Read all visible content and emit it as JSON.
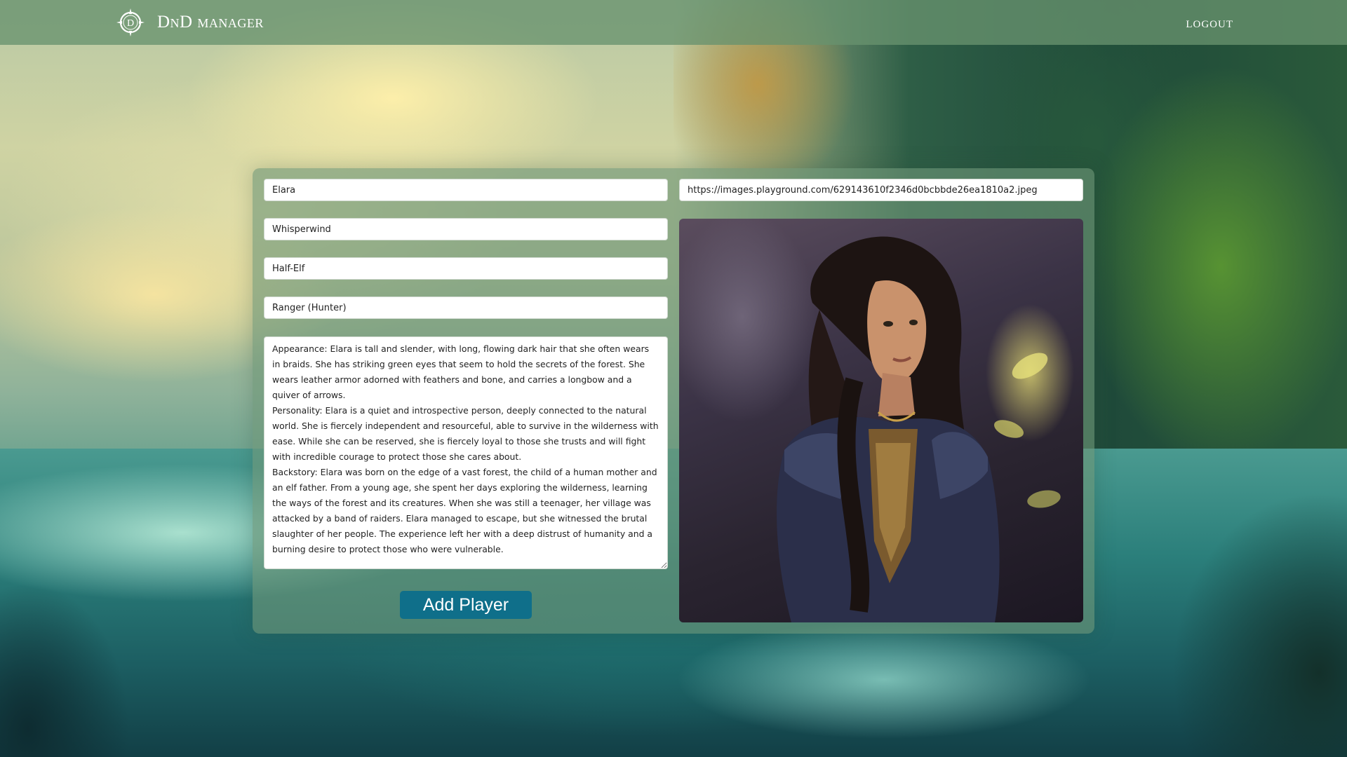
{
  "navbar": {
    "brand_title": "DnD manager",
    "logout_label": "logout"
  },
  "form": {
    "first_name": "Elara",
    "last_name": "Whisperwind",
    "race": "Half-Elf",
    "class": "Ranger (Hunter)",
    "image_url": "https://images.playground.com/629143610f2346d0bcbbde26ea1810a2.jpeg",
    "description": "Appearance: Elara is tall and slender, with long, flowing dark hair that she often wears in braids. She has striking green eyes that seem to hold the secrets of the forest. She wears leather armor adorned with feathers and bone, and carries a longbow and a quiver of arrows.\nPersonality: Elara is a quiet and introspective person, deeply connected to the natural world. She is fiercely independent and resourceful, able to survive in the wilderness with ease. While she can be reserved, she is fiercely loyal to those she trusts and will fight with incredible courage to protect those she cares about.\nBackstory: Elara was born on the edge of a vast forest, the child of a human mother and an elf father. From a young age, she spent her days exploring the wilderness, learning the ways of the forest and its creatures. When she was still a teenager, her village was attacked by a band of raiders. Elara managed to escape, but she witnessed the brutal slaughter of her people. The experience left her with a deep distrust of humanity and a burning desire to protect those who were vulnerable.",
    "submit_label": "Add Player"
  },
  "colors": {
    "navbar_bg": "#68926e",
    "card_bg": "#6e9678",
    "button_bg": "#0f6f8a"
  },
  "icons": {
    "logo": "dnd-compass-logo-icon"
  }
}
